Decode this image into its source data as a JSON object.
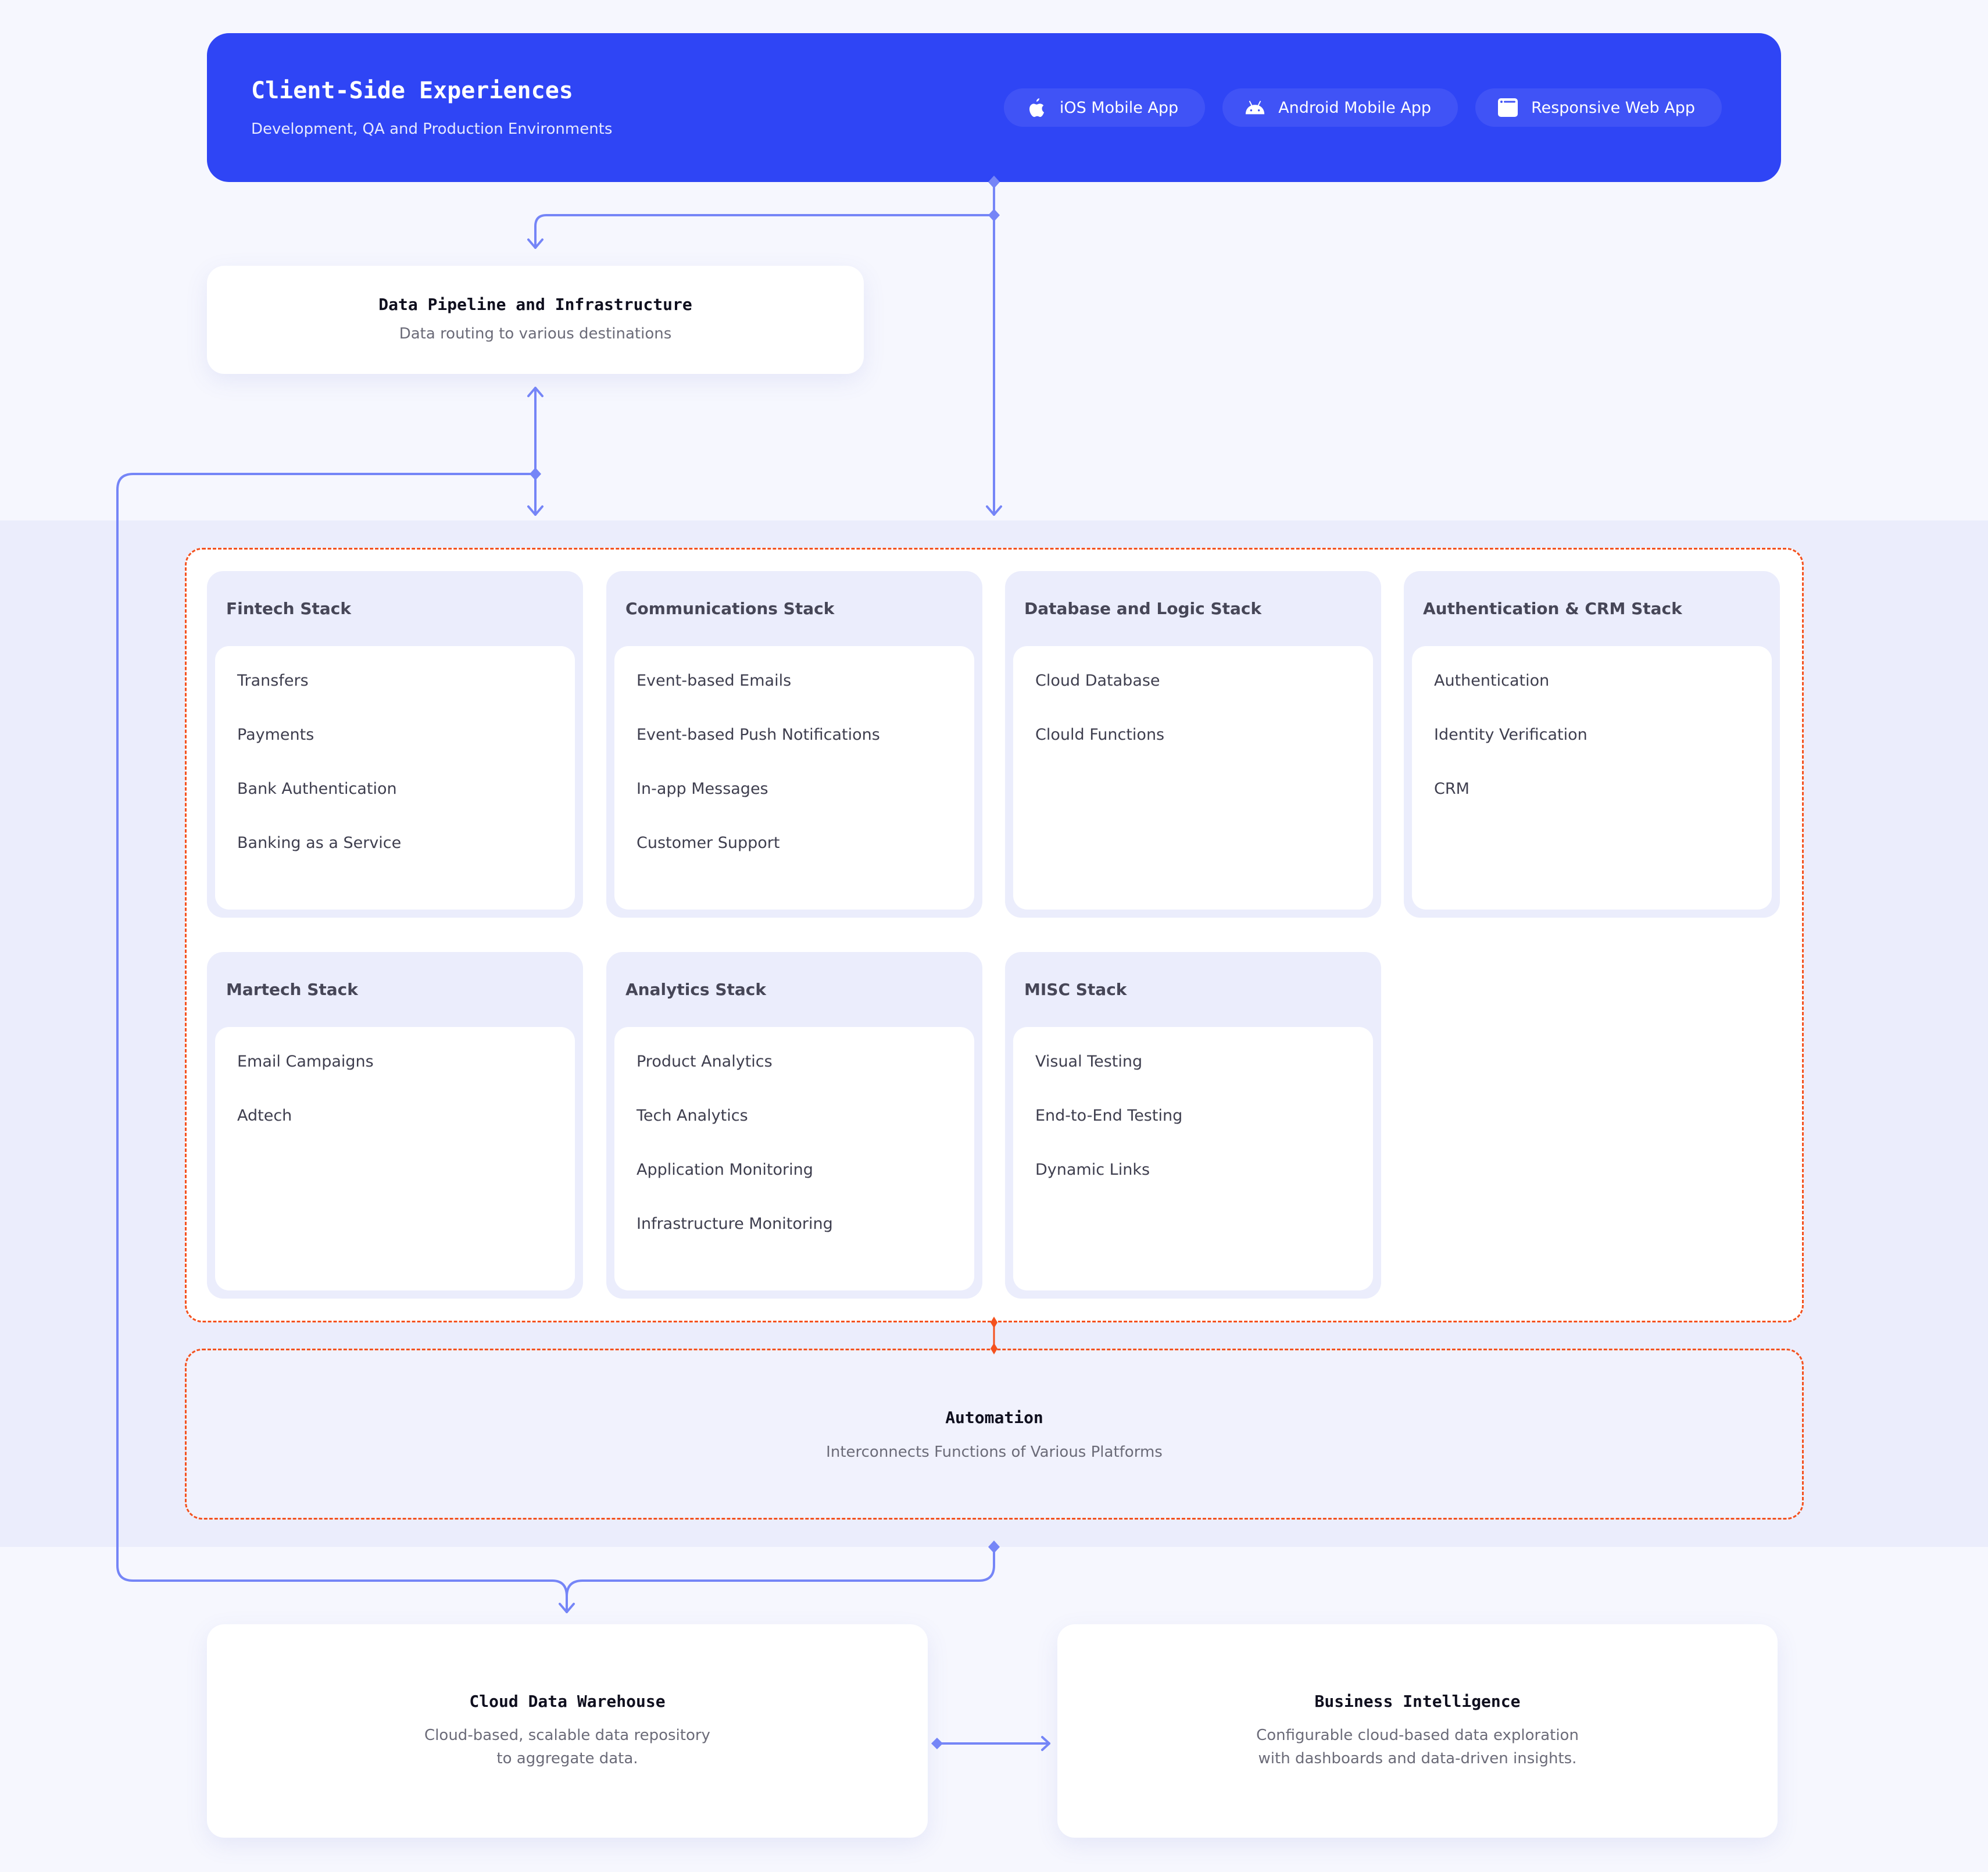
{
  "colors": {
    "primary": "#2f45f5",
    "connector": "#7585f7",
    "dashed_border": "#f4511e",
    "band": "#ebedfc",
    "background": "#f6f7fe"
  },
  "client": {
    "title": "Client-Side Experiences",
    "subtitle": "Development, QA and Production Environments",
    "apps": [
      {
        "label": "iOS Mobile App",
        "icon": "apple-icon"
      },
      {
        "label": "Android Mobile App",
        "icon": "android-icon"
      },
      {
        "label": "Responsive Web App",
        "icon": "browser-window-icon"
      }
    ]
  },
  "pipeline": {
    "title": "Data Pipeline and Infrastructure",
    "description": "Data routing to various destinations"
  },
  "stacks": [
    {
      "title": "Fintech Stack",
      "items": [
        "Transfers",
        "Payments",
        "Bank Authentication",
        "Banking as a Service"
      ]
    },
    {
      "title": "Communications Stack",
      "items": [
        "Event-based Emails",
        "Event-based Push Notifications",
        "In-app Messages",
        "Customer Support"
      ]
    },
    {
      "title": "Database and Logic Stack",
      "items": [
        "Cloud Database",
        "Clould Functions"
      ]
    },
    {
      "title": "Authentication & CRM Stack",
      "items": [
        "Authentication",
        "Identity Verification",
        "CRM"
      ]
    },
    {
      "title": "Martech Stack",
      "items": [
        "Email Campaigns",
        "Adtech"
      ]
    },
    {
      "title": "Analytics Stack",
      "items": [
        "Product Analytics",
        "Tech Analytics",
        "Application Monitoring",
        "Infrastructure Monitoring"
      ]
    },
    {
      "title": "MISC Stack",
      "items": [
        "Visual Testing",
        "End-to-End Testing",
        "Dynamic Links"
      ]
    }
  ],
  "automation": {
    "title": "Automation",
    "description": "Interconnects Functions of Various Platforms"
  },
  "warehouse": {
    "title": "Cloud Data Warehouse",
    "description": "Cloud-based, scalable data repository\nto aggregate data."
  },
  "bi": {
    "title": "Business Intelligence",
    "description": "Configurable cloud-based data exploration\nwith dashboards and data-driven insights."
  }
}
